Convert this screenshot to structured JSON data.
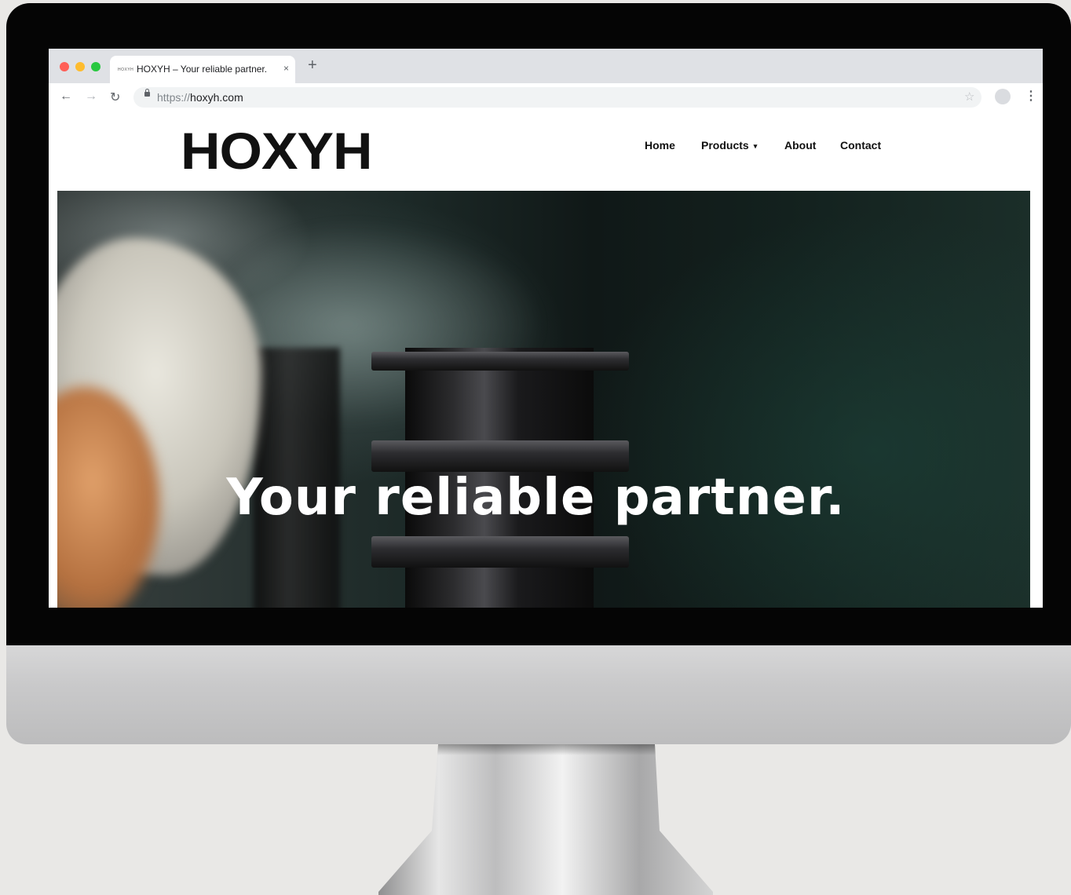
{
  "browser": {
    "tab_favicon": "HOXYH",
    "tab_title": "HOXYH – Your reliable partner.",
    "tab_close": "×",
    "new_tab": "+",
    "url_scheme": "https://",
    "url_host": "hoxyh.com",
    "icons": [
      "back-arrow-icon",
      "forward-arrow-icon",
      "reload-icon",
      "lock-icon",
      "star-icon",
      "profile-icon",
      "kebab-menu-icon"
    ]
  },
  "site": {
    "logo": "HOXYH",
    "nav": {
      "home": "Home",
      "products": "Products",
      "products_caret": "▾",
      "about": "About",
      "contact": "Contact"
    },
    "hero": {
      "headline": "Your reliable partner."
    }
  },
  "colors": {
    "bezel": "#050505",
    "hero_text": "#ffffff",
    "logo": "#111111"
  }
}
